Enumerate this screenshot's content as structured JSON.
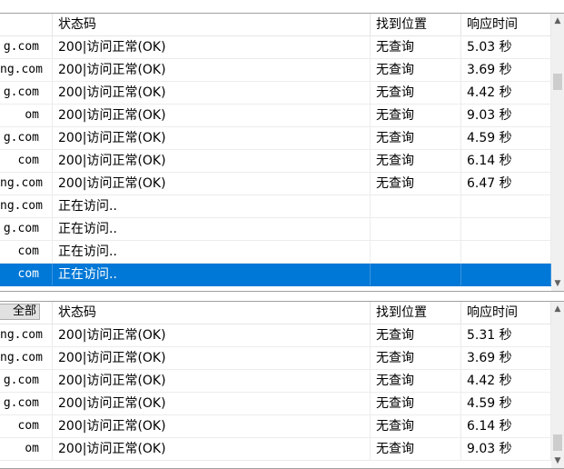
{
  "top_table": {
    "headers": {
      "status": "状态码",
      "found": "找到位置",
      "time": "响应时间"
    },
    "rows": [
      {
        "domain": "g.com",
        "status": "200|访问正常(OK)",
        "found": "无查询",
        "time": "5.03 秒"
      },
      {
        "domain": "ng.com",
        "status": "200|访问正常(OK)",
        "found": "无查询",
        "time": "3.69 秒"
      },
      {
        "domain": "g.com",
        "status": "200|访问正常(OK)",
        "found": "无查询",
        "time": "4.42 秒"
      },
      {
        "domain": "om",
        "status": "200|访问正常(OK)",
        "found": "无查询",
        "time": "9.03 秒"
      },
      {
        "domain": "g.com",
        "status": "200|访问正常(OK)",
        "found": "无查询",
        "time": "4.59 秒"
      },
      {
        "domain": "com",
        "status": "200|访问正常(OK)",
        "found": "无查询",
        "time": "6.14 秒"
      },
      {
        "domain": "ng.com",
        "status": "200|访问正常(OK)",
        "found": "无查询",
        "time": "6.47 秒"
      },
      {
        "domain": "ng.com",
        "status": "正在访问..",
        "found": "",
        "time": ""
      },
      {
        "domain": "g.com",
        "status": "正在访问..",
        "found": "",
        "time": ""
      },
      {
        "domain": "com",
        "status": "正在访问..",
        "found": "",
        "time": ""
      },
      {
        "domain": "com",
        "status": "正在访问..",
        "found": "",
        "time": "",
        "selected": true
      }
    ]
  },
  "bottom_table": {
    "select_all_label": "全部",
    "headers": {
      "status": "状态码",
      "found": "找到位置",
      "time": "响应时间"
    },
    "rows": [
      {
        "domain": "ng.com",
        "status": "200|访问正常(OK)",
        "found": "无查询",
        "time": "5.31 秒"
      },
      {
        "domain": "ng.com",
        "status": "200|访问正常(OK)",
        "found": "无查询",
        "time": "3.69 秒"
      },
      {
        "domain": "g.com",
        "status": "200|访问正常(OK)",
        "found": "无查询",
        "time": "4.42 秒"
      },
      {
        "domain": "g.com",
        "status": "200|访问正常(OK)",
        "found": "无查询",
        "time": "4.59 秒"
      },
      {
        "domain": "com",
        "status": "200|访问正常(OK)",
        "found": "无查询",
        "time": "6.14 秒"
      },
      {
        "domain": "om",
        "status": "200|访问正常(OK)",
        "found": "无查询",
        "time": "9.03 秒"
      }
    ]
  },
  "colors": {
    "selection": "#0078d7",
    "scrollbar": "#f0f0f0",
    "thumb": "#cdcdcd"
  }
}
